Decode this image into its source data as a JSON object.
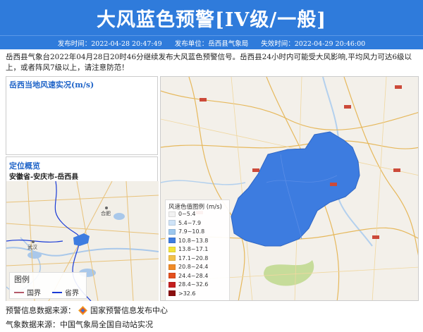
{
  "header": {
    "title": "大风蓝色预警[IV级/一般]",
    "publish_time": "发布时间：2022-04-28 20:47:49",
    "publisher": "发布单位：岳西县气象局",
    "expire_time": "失效时间：2022-04-29 20:46:00"
  },
  "description": "岳西县气象台2022年04月28日20时46分继续发布大风蓝色预警信号。岳西县24小时内可能受大风影响,平均风力可达6级以上，或者阵风7级以上，请注意防范！",
  "wind_panel": {
    "title": "岳西当地风速实况(m/s)"
  },
  "location_panel": {
    "title": "定位概览",
    "location": "安徽省-安庆市-岳西县",
    "map_labels": {
      "hefei": "合肥",
      "wuhan": "武汉"
    },
    "legend": {
      "title": "图例",
      "border_country": "国界",
      "border_province": "省界"
    }
  },
  "wind_legend": {
    "title": "风速色值图例 (m/s)",
    "items": [
      {
        "label": "0~5.4",
        "color": "#f2f2f2"
      },
      {
        "label": "5.4~7.9",
        "color": "#cfe3f7"
      },
      {
        "label": "7.9~10.8",
        "color": "#9cc7ee"
      },
      {
        "label": "10.8~13.8",
        "color": "#3d7ce0"
      },
      {
        "label": "13.8~17.1",
        "color": "#f3e43a"
      },
      {
        "label": "17.1~20.8",
        "color": "#f2c14a"
      },
      {
        "label": "20.8~24.4",
        "color": "#f08b28"
      },
      {
        "label": "24.4~28.4",
        "color": "#e4501e"
      },
      {
        "label": "28.4~32.6",
        "color": "#c51f1f"
      },
      {
        "label": ">32.6",
        "color": "#8b0f0f"
      }
    ]
  },
  "footer": {
    "warning_source": "预警信息数据来源：",
    "warning_source_name": "国家预警信息发布中心",
    "weather_source": "气象数据来源：中国气象局全国自动站实况"
  },
  "colors": {
    "accent": "#2f7bdb",
    "region": "#3d7ce0",
    "panel_title": "#1f64c8"
  }
}
